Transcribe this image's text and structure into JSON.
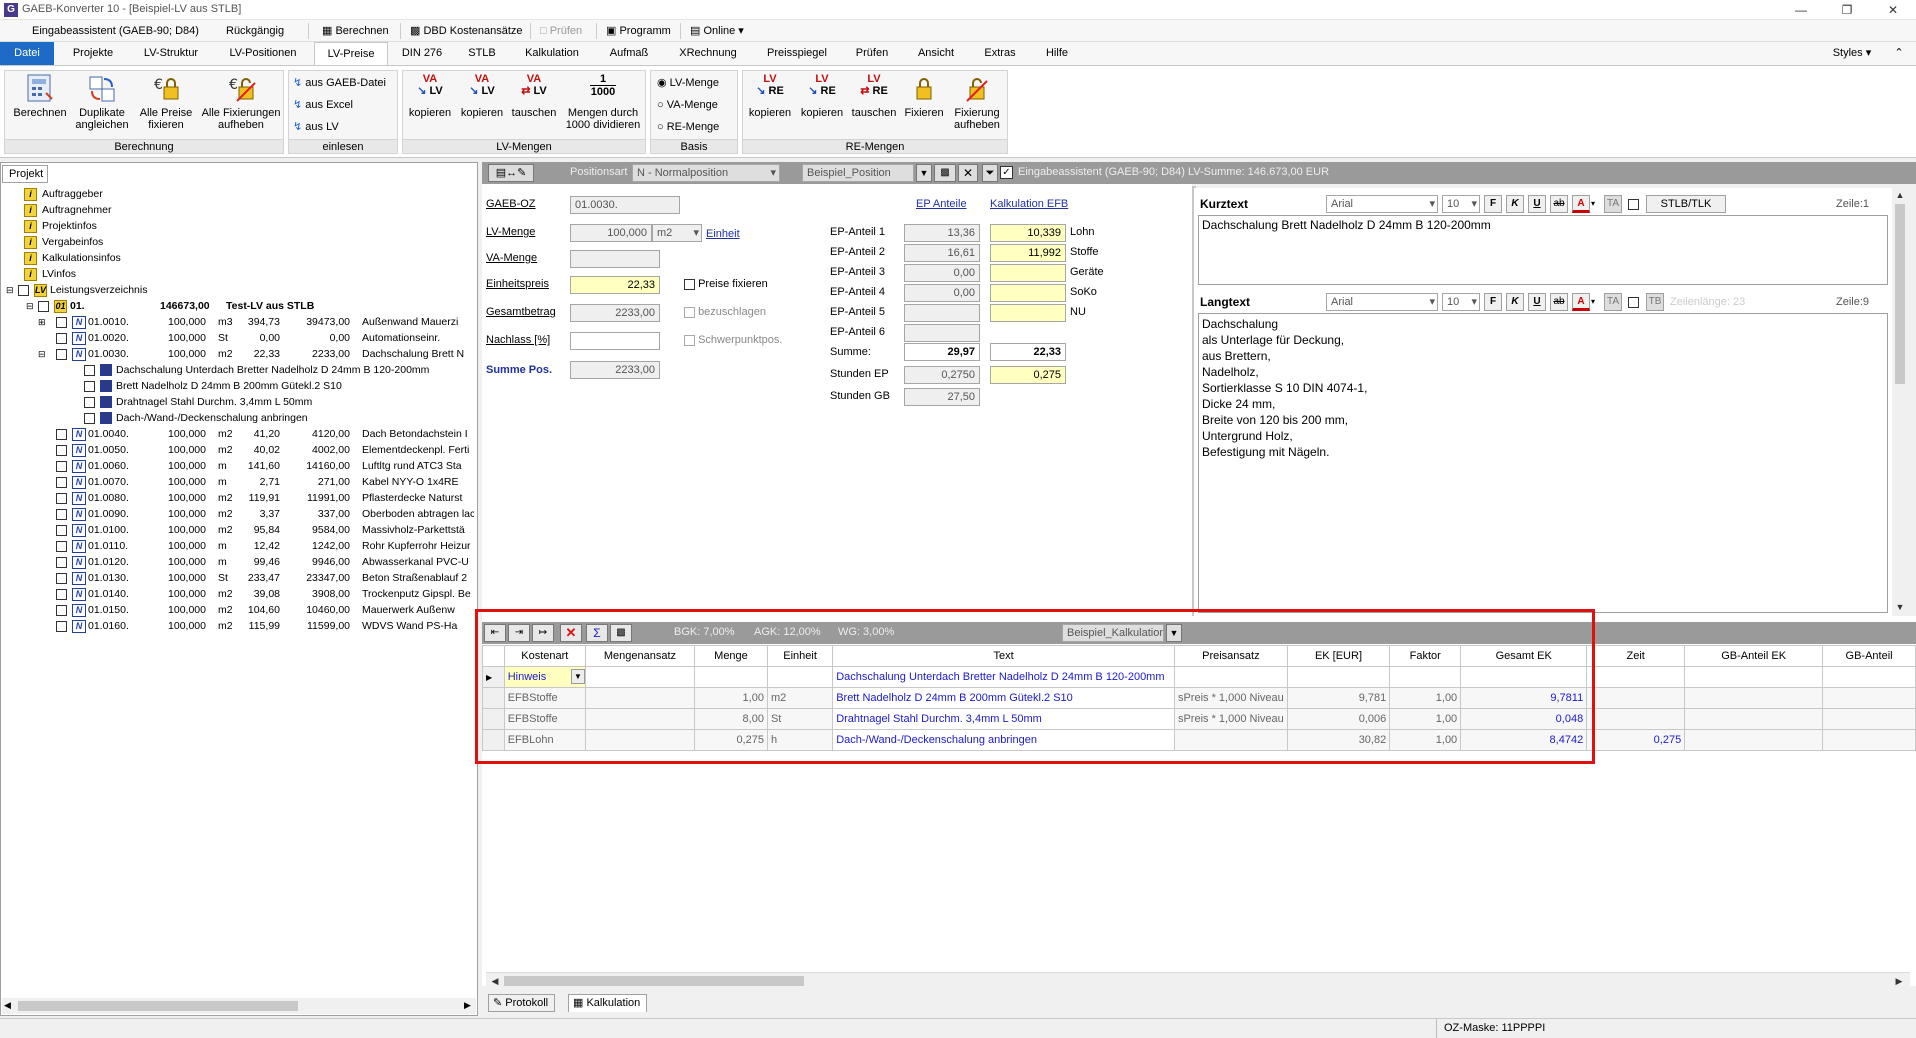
{
  "window": {
    "title": "GAEB-Konverter 10 - [Beispiel-LV aus STLB]"
  },
  "quickbar": {
    "assistant": "Eingabeassistent (GAEB-90; D84)",
    "undo": "Rückgängig",
    "calc": "Berechnen",
    "dbd": "DBD Kostenansätze",
    "check": "Prüfen",
    "program": "Programm",
    "online": "Online"
  },
  "menu": [
    "Datei",
    "Projekte",
    "LV-Struktur",
    "LV-Positionen",
    "LV-Preise",
    "DIN 276",
    "STLB",
    "Kalkulation",
    "Aufmaß",
    "XRechnung",
    "Preisspiegel",
    "Prüfen",
    "Ansicht",
    "Extras",
    "Hilfe"
  ],
  "styles": "Styles",
  "ribbon": {
    "g1": {
      "label": "Berechnung",
      "b1": "Berechnen",
      "b2a": "Duplikate",
      "b2b": "angleichen",
      "b3a": "Alle Preise",
      "b3b": "fixieren",
      "b4a": "Alle Fixierungen",
      "b4b": "aufheben"
    },
    "g2": {
      "label": "einlesen",
      "i1": "aus GAEB-Datei",
      "i2": "aus Excel",
      "i3": "aus LV"
    },
    "g3": {
      "label": "LV-Mengen",
      "b1": "kopieren",
      "b2": "kopieren",
      "b3": "tauschen",
      "b4a": "Mengen durch",
      "b4b": "1000 dividieren",
      "ico1": "VA",
      "ico1b": "LV",
      "ico4a": "1",
      "ico4b": "1000"
    },
    "g4": {
      "label": "Basis",
      "r1": "LV-Menge",
      "r2": "VA-Menge",
      "r3": "RE-Menge"
    },
    "g5": {
      "label": "RE-Mengen",
      "b1": "kopieren",
      "b2": "kopieren",
      "b3": "tauschen",
      "b4": "Fixieren",
      "b5a": "Fixierung",
      "b5b": "aufheben",
      "ico_lv": "LV",
      "ico_re": "RE"
    }
  },
  "left": {
    "tab": "Projekt",
    "top": [
      "Auftraggeber",
      "Auftragnehmer",
      "Projektinfos",
      "Vergabeinfos",
      "Kalkulationsinfos",
      "LVinfos"
    ],
    "lv": "Leistungsverzeichnis",
    "group": {
      "oz": "01.",
      "sum": "146673,00",
      "text": "Test-LV aus STLB"
    },
    "rows": [
      {
        "oz": "01.0010.",
        "q": "100,000",
        "u": "m3",
        "ep": "394,73",
        "gp": "39473,00",
        "t": "Außenwand Mauerzi"
      },
      {
        "oz": "01.0020.",
        "q": "100,000",
        "u": "St",
        "ep": "0,00",
        "gp": "0,00",
        "t": "Automationseinr."
      },
      {
        "oz": "01.0030.",
        "q": "100,000",
        "u": "m2",
        "ep": "22,33",
        "gp": "2233,00",
        "t": "Dachschalung Brett N"
      }
    ],
    "sub": [
      "Dachschalung Unterdach Bretter Nadelholz D 24mm B 120-200mm",
      "Brett Nadelholz D 24mm B 200mm Gütekl.2 S10",
      "Drahtnagel Stahl Durchm. 3,4mm L 50mm",
      "Dach-/Wand-/Deckenschalung anbringen"
    ],
    "rows2": [
      {
        "oz": "01.0040.",
        "q": "100,000",
        "u": "m2",
        "ep": "41,20",
        "gp": "4120,00",
        "t": "Dach Betondachstein I"
      },
      {
        "oz": "01.0050.",
        "q": "100,000",
        "u": "m2",
        "ep": "40,02",
        "gp": "4002,00",
        "t": "Elementdeckenpl. Ferti"
      },
      {
        "oz": "01.0060.",
        "q": "100,000",
        "u": "m",
        "ep": "141,60",
        "gp": "14160,00",
        "t": "Luftltg rund ATC3 Sta"
      },
      {
        "oz": "01.0070.",
        "q": "100,000",
        "u": "m",
        "ep": "2,71",
        "gp": "271,00",
        "t": "Kabel NYY-O 1x4RE"
      },
      {
        "oz": "01.0080.",
        "q": "100,000",
        "u": "m2",
        "ep": "119,91",
        "gp": "11991,00",
        "t": "Pflasterdecke Naturst"
      },
      {
        "oz": "01.0090.",
        "q": "100,000",
        "u": "m2",
        "ep": "3,37",
        "gp": "337,00",
        "t": "Oberboden abtragen lac"
      },
      {
        "oz": "01.0100.",
        "q": "100,000",
        "u": "m2",
        "ep": "95,84",
        "gp": "9584,00",
        "t": "Massivholz-Parkettstä"
      },
      {
        "oz": "01.0110.",
        "q": "100,000",
        "u": "m",
        "ep": "12,42",
        "gp": "1242,00",
        "t": "Rohr Kupferrohr Heizur"
      },
      {
        "oz": "01.0120.",
        "q": "100,000",
        "u": "m",
        "ep": "99,46",
        "gp": "9946,00",
        "t": "Abwasserkanal PVC-U"
      },
      {
        "oz": "01.0130.",
        "q": "100,000",
        "u": "St",
        "ep": "233,47",
        "gp": "23347,00",
        "t": "Beton Straßenablauf 2"
      },
      {
        "oz": "01.0140.",
        "q": "100,000",
        "u": "m2",
        "ep": "39,08",
        "gp": "3908,00",
        "t": "Trockenputz Gipspl. Be"
      },
      {
        "oz": "01.0150.",
        "q": "100,000",
        "u": "m2",
        "ep": "104,60",
        "gp": "10460,00",
        "t": "Mauerwerk Außenw"
      },
      {
        "oz": "01.0160.",
        "q": "100,000",
        "u": "m2",
        "ep": "115,99",
        "gp": "11599,00",
        "t": "WDVS Wand PS-Ha"
      }
    ]
  },
  "postool": {
    "posart_label": "Positionsart",
    "posart": "N - Normalposition",
    "profile": "Beispiel_Position",
    "info": "Eingabeassistent (GAEB-90; D84)   LV-Summe: 146.673,00 EUR"
  },
  "form": {
    "oz_label": "GAEB-OZ",
    "oz": "01.0030.",
    "lvm_label": "LV-Menge",
    "lvm": "100,000",
    "unit": "m2",
    "einheit": "Einheit",
    "vam_label": "VA-Menge",
    "ep_label": "Einheitspreis",
    "ep": "22,33",
    "fix": "Preise fixieren",
    "gb_label": "Gesamtbetrag",
    "gb": "2233,00",
    "bez": "bezuschlagen",
    "nl_label": "Nachlass [%]",
    "schw": "Schwerpunktpos.",
    "sum_label": "Summe Pos.",
    "sum": "2233,00",
    "ep_anteile": "EP Anteile",
    "kalk_efb": "Kalkulation EFB",
    "anteile": [
      {
        "l": "EP-Anteil 1",
        "a": "13,36",
        "b": "10,339",
        "n": "Lohn"
      },
      {
        "l": "EP-Anteil 2",
        "a": "16,61",
        "b": "11,992",
        "n": "Stoffe"
      },
      {
        "l": "EP-Anteil 3",
        "a": "0,00",
        "b": "",
        "n": "Geräte"
      },
      {
        "l": "EP-Anteil 4",
        "a": "0,00",
        "b": "",
        "n": "SoKo"
      },
      {
        "l": "EP-Anteil 5",
        "a": "",
        "b": "",
        "n": "NU"
      },
      {
        "l": "EP-Anteil 6",
        "a": "",
        "b": "",
        "n": ""
      }
    ],
    "summe_label": "Summe:",
    "summe_a": "29,97",
    "summe_b": "22,33",
    "sep_label": "Stunden EP",
    "sep_a": "0,2750",
    "sep_b": "0,275",
    "sgb_label": "Stunden GB",
    "sgb_a": "27,50"
  },
  "kurz": {
    "label": "Kurztext",
    "font": "Arial",
    "size": "10",
    "btns": [
      "F",
      "K",
      "U",
      "ab",
      "A",
      "TA"
    ],
    "stlb": "STLB/TLK",
    "zeile": "Zeile:1",
    "text": "Dachschalung Brett Nadelholz D 24mm B 120-200mm"
  },
  "lang": {
    "label": "Langtext",
    "font": "Arial",
    "size": "10",
    "tb": "TB",
    "zeilen": "Zeilenlänge: 23",
    "zeile": "Zeile:9",
    "lines": [
      "Dachschalung",
      "als Unterlage für Deckung,",
      "aus Brettern,",
      "Nadelholz,",
      "Sortierklasse S 10 DIN 4074-1,",
      "Dicke 24 mm,",
      "Breite von 120 bis 200 mm,",
      "Untergrund Holz,",
      "Befestigung mit Nägeln."
    ]
  },
  "calc": {
    "bgk": "BGK: 7,00%",
    "agk": "AGK: 12,00%",
    "wg": "WG: 3,00%",
    "profile": "Beispiel_Kalkulation",
    "headers": [
      "Kostenart",
      "Mengenansatz",
      "Menge",
      "Einheit",
      "Text",
      "Preisansatz",
      "EK [EUR]",
      "Faktor",
      "Gesamt EK",
      "Zeit",
      "GB-Anteil EK",
      "GB-Anteil"
    ],
    "rows": [
      {
        "k": "Hinweis",
        "ma": "",
        "m": "",
        "e": "",
        "t": "Dachschalung Unterdach Bretter Nadelholz D 24mm B 120-200mm",
        "p": "",
        "ek": "",
        "f": "",
        "g": "",
        "z": ""
      },
      {
        "k": "EFBStoffe",
        "ma": "",
        "m": "1,00",
        "e": "m2",
        "t": "Brett Nadelholz D 24mm B 200mm Gütekl.2 S10",
        "p": "sPreis * 1,000 Niveau",
        "ek": "9,781",
        "f": "1,00",
        "g": "9,7811",
        "z": ""
      },
      {
        "k": "EFBStoffe",
        "ma": "",
        "m": "8,00",
        "e": "St",
        "t": "Drahtnagel Stahl Durchm. 3,4mm L 50mm",
        "p": "sPreis * 1,000 Niveau",
        "ek": "0,006",
        "f": "1,00",
        "g": "0,048",
        "z": ""
      },
      {
        "k": "EFBLohn",
        "ma": "",
        "m": "0,275",
        "e": "h",
        "t": "Dach-/Wand-/Deckenschalung anbringen",
        "p": "",
        "ek": "30,82",
        "f": "1,00",
        "g": "8,4742",
        "z": "0,275"
      }
    ]
  },
  "tabs": {
    "protokoll": "Protokoll",
    "kalk": "Kalkulation"
  },
  "status": {
    "mask": "OZ-Maske: 11PPPPI"
  }
}
